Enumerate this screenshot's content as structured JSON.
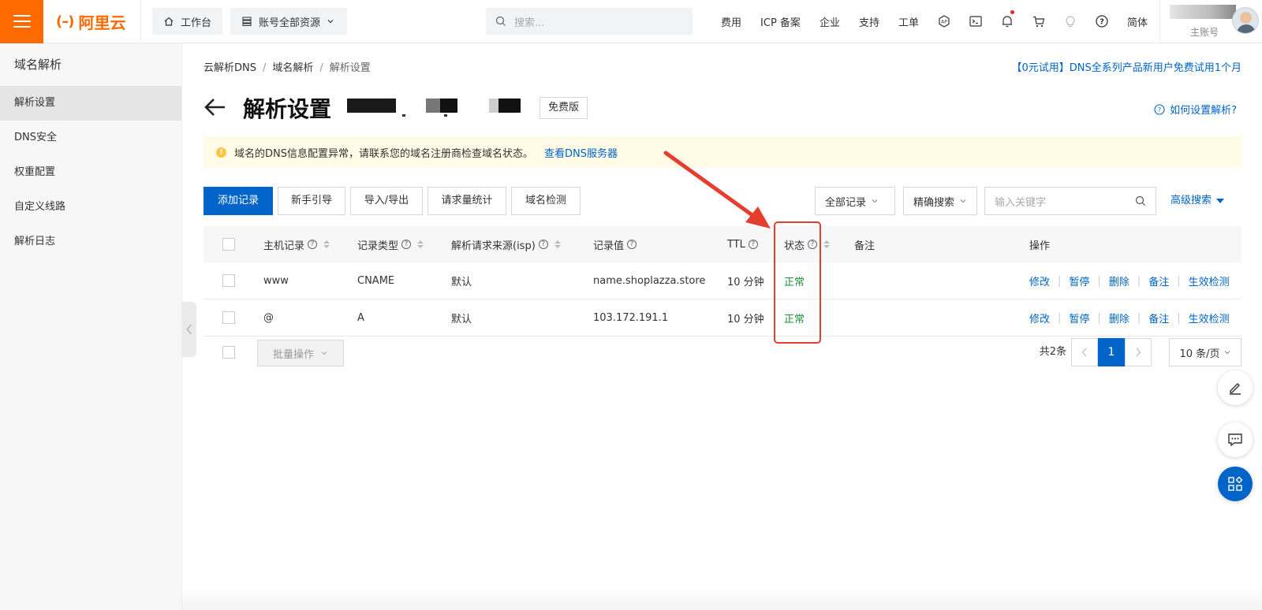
{
  "topbar": {
    "logo_text": "阿里云",
    "workbench": "工作台",
    "resources": "账号全部资源",
    "search_placeholder": "搜索...",
    "links": [
      "费用",
      "ICP 备案",
      "企业",
      "支持",
      "工单"
    ],
    "lang": "简体",
    "account_label": "主账号"
  },
  "sidebar": {
    "title": "域名解析",
    "items": [
      "解析设置",
      "DNS安全",
      "权重配置",
      "自定义线路",
      "解析日志"
    ],
    "active_index": 0
  },
  "breadcrumb": [
    "云解析DNS",
    "域名解析",
    "解析设置"
  ],
  "promo": "【0元试用】DNS全系列产品新用户免费试用1个月",
  "page": {
    "title": "解析设置",
    "edition": "免费版",
    "howto": "如何设置解析?"
  },
  "notice": {
    "text": "域名的DNS信息配置异常，请联系您的域名注册商检查域名状态。",
    "link": "查看DNS服务器"
  },
  "toolbar": {
    "add": "添加记录",
    "guide": "新手引导",
    "import_export": "导入/导出",
    "stats": "请求量统计",
    "check": "域名检测",
    "filter_all": "全部记录",
    "search_mode": "精确搜索",
    "keyword_placeholder": "输入关键字",
    "advanced": "高级搜索"
  },
  "table": {
    "headers": {
      "host": "主机记录",
      "type": "记录类型",
      "isp": "解析请求来源(isp)",
      "value": "记录值",
      "ttl": "TTL",
      "status": "状态",
      "remark": "备注",
      "ops": "操作"
    },
    "rows": [
      {
        "host": "www",
        "type": "CNAME",
        "isp": "默认",
        "value": "name.shoplazza.store",
        "ttl": "10 分钟",
        "status": "正常",
        "remark": ""
      },
      {
        "host": "@",
        "type": "A",
        "isp": "默认",
        "value": "103.172.191.1",
        "ttl": "10 分钟",
        "status": "正常",
        "remark": ""
      }
    ],
    "ops": [
      "修改",
      "暂停",
      "删除",
      "备注",
      "生效检测"
    ]
  },
  "footer": {
    "batch": "批量操作",
    "total": "共2条",
    "current_page": "1",
    "page_size": "10 条/页"
  },
  "colors": {
    "brand": "#ff6a00",
    "primary": "#0064c8",
    "ok": "#1e8e3e",
    "annotation": "#e53e2f"
  }
}
